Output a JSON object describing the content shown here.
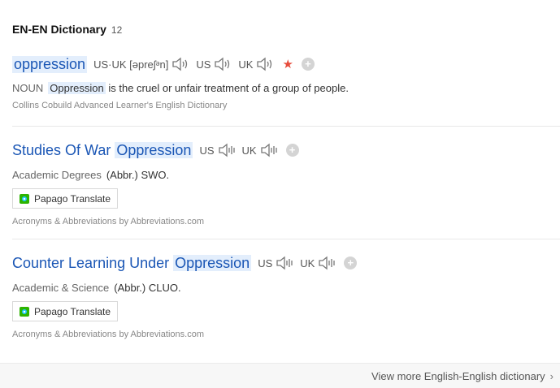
{
  "header": {
    "title": "EN-EN Dictionary",
    "count": "12"
  },
  "entry1": {
    "word": "oppression",
    "pron_us_uk": "US·UK [əpreʃᵊn]",
    "us_label": "US",
    "uk_label": "UK",
    "pos": "NOUN",
    "def_word": "Oppression",
    "def_rest": " is the cruel or unfair treatment of a group of people.",
    "source": "Collins Cobuild Advanced Learner's English Dictionary"
  },
  "entry2": {
    "word_pre": "Studies Of War ",
    "word_hl": "Oppression",
    "us_label": "US",
    "uk_label": "UK",
    "category": "Academic Degrees",
    "abbr": "(Abbr.) SWO.",
    "papago": "Papago Translate",
    "source": "Acronyms & Abbreviations by Abbreviations.com"
  },
  "entry3": {
    "word_pre": "Counter Learning Under ",
    "word_hl": "Oppression",
    "us_label": "US",
    "uk_label": "UK",
    "category": "Academic & Science",
    "abbr": "(Abbr.) CLUO.",
    "papago": "Papago Translate",
    "source": "Acronyms & Abbreviations by Abbreviations.com"
  },
  "footer": {
    "link": "View more English-English dictionary"
  },
  "colors": {
    "link": "#1a56b5",
    "highlight": "#e3eefc",
    "star": "#e74c3c"
  },
  "icons": [
    "speaker-icon",
    "star-icon",
    "add-icon",
    "papago-icon",
    "chevron-right-icon"
  ]
}
